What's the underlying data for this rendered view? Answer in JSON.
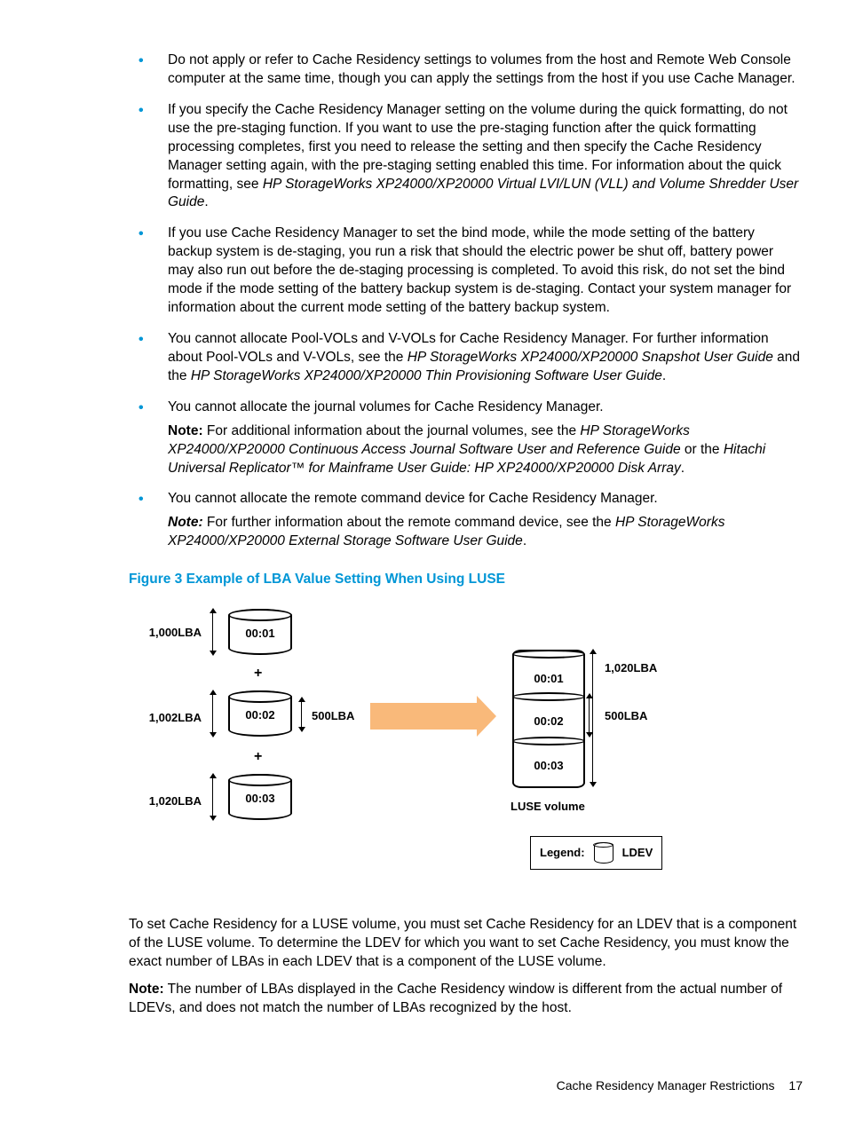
{
  "bullets": {
    "b1": "Do not apply or refer to Cache Residency settings to volumes from the host and Remote Web Console computer at the same time, though you can apply the settings from the host if you use Cache Manager.",
    "b2_a": "If you specify the Cache Residency Manager setting on the volume during the quick formatting, do not use the pre-staging function. If you want to use the pre-staging function after the quick formatting processing completes, first you need to release the setting and then specify the Cache Residency Manager setting again, with the pre-staging setting enabled this time. For information about the quick formatting, see ",
    "b2_i": "HP StorageWorks XP24000/XP20000 Virtual LVI/LUN (VLL) and Volume Shredder User Guide",
    "b2_b": ".",
    "b3": "If you use Cache Residency Manager to set the bind mode, while the mode setting of the battery backup system is de-staging, you run a risk that should the electric power be shut off, battery power may also run out before the de-staging processing is completed. To avoid this risk, do not set the bind mode if the mode setting of the battery backup system is de-staging. Contact your system manager for information about the current mode setting of the battery backup system.",
    "b4_a": "You cannot allocate Pool-VOLs and V-VOLs for Cache Residency Manager. For further information about Pool-VOLs and V-VOLs, see the ",
    "b4_i1": "HP StorageWorks XP24000/XP20000 Snapshot User Guide",
    "b4_mid": " and the ",
    "b4_i2": "HP StorageWorks XP24000/XP20000 Thin Provisioning Software User Guide",
    "b4_b": ".",
    "b5": "You cannot allocate the journal volumes for Cache Residency Manager.",
    "b5_note_label": "Note:",
    "b5_note_a": " For additional information about the journal volumes, see the ",
    "b5_note_i1": "HP StorageWorks XP24000/XP20000 Continuous Access Journal Software User and Reference Guide",
    "b5_note_mid": " or the ",
    "b5_note_i2": "Hitachi Universal Replicator™ for Mainframe User Guide: HP XP24000/XP20000 Disk Array",
    "b5_note_b": ".",
    "b6": "You cannot allocate the remote command device for Cache Residency Manager.",
    "b6_note_label": "Note:",
    "b6_note_a": " For further information about the remote command device, see the ",
    "b6_note_i": "HP StorageWorks XP24000/XP20000 External Storage Software User Guide",
    "b6_note_b": "."
  },
  "figure": {
    "caption": "Figure 3 Example of LBA Value Setting When Using LUSE",
    "left": {
      "lba1": "1,000LBA",
      "id1": "00:01",
      "lba2": "1,002LBA",
      "id2": "00:02",
      "mid": "500LBA",
      "lba3": "1,020LBA",
      "id3": "00:03"
    },
    "right": {
      "lba_top": "1,020LBA",
      "mid": "500LBA",
      "seg1": "00:01",
      "seg2": "00:02",
      "seg3": "00:03",
      "luse_label": "LUSE volume"
    },
    "plus": "+",
    "legend_label": "Legend:",
    "legend_val": "LDEV"
  },
  "paragraphs": {
    "p1": "To set Cache Residency for a LUSE volume, you must set Cache Residency for an LDEV that is a component of the LUSE volume. To determine the LDEV for which you want to set Cache Residency, you must know the exact number of LBAs in each LDEV that is a component of the LUSE volume.",
    "p2_label": "Note:",
    "p2": " The number of LBAs displayed in the Cache Residency window is different from the actual number of LDEVs, and does not match the number of LBAs recognized by the host."
  },
  "footer": {
    "section": "Cache Residency Manager Restrictions",
    "page": "17"
  }
}
